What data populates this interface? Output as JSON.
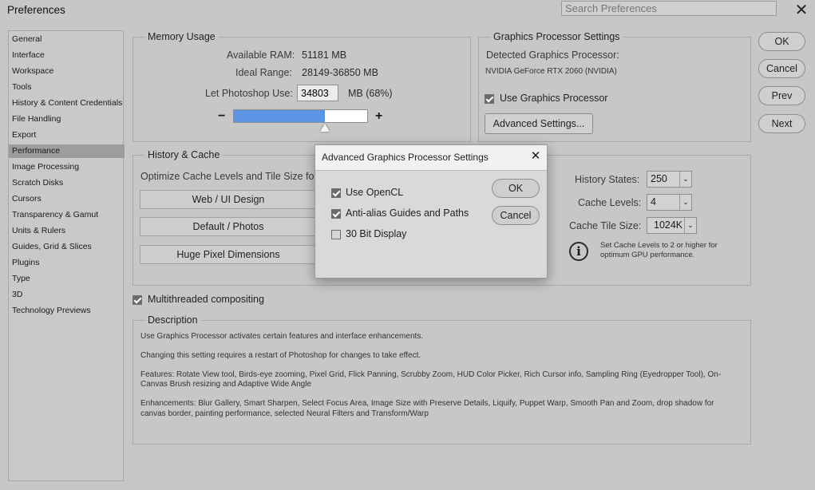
{
  "window": {
    "title": "Preferences",
    "search_placeholder": "Search Preferences",
    "close_glyph": "✕"
  },
  "sidebar": {
    "items": [
      {
        "label": "General"
      },
      {
        "label": "Interface"
      },
      {
        "label": "Workspace"
      },
      {
        "label": "Tools"
      },
      {
        "label": "History & Content Credentials"
      },
      {
        "label": "File Handling"
      },
      {
        "label": "Export"
      },
      {
        "label": "Performance",
        "selected": true
      },
      {
        "label": "Image Processing"
      },
      {
        "label": "Scratch Disks"
      },
      {
        "label": "Cursors"
      },
      {
        "label": "Transparency & Gamut"
      },
      {
        "label": "Units & Rulers"
      },
      {
        "label": "Guides, Grid & Slices"
      },
      {
        "label": "Plugins"
      },
      {
        "label": "Type"
      },
      {
        "label": "3D"
      },
      {
        "label": "Technology Previews"
      }
    ]
  },
  "memory": {
    "title": "Memory Usage",
    "available_label": "Available RAM:",
    "available_value": "51181 MB",
    "ideal_label": "Ideal Range:",
    "ideal_value": "28149-36850 MB",
    "use_label": "Let Photoshop Use:",
    "use_value": "34803",
    "use_unit": "MB (68%)",
    "minus": "−",
    "plus": "+",
    "slider_fraction": 0.68
  },
  "gpu": {
    "title": "Graphics Processor Settings",
    "detected_label": "Detected Graphics Processor:",
    "gpu_name": "NVIDIA GeForce RTX 2060 (NVIDIA)",
    "use_gpu_label": "Use Graphics Processor",
    "use_gpu_checked": true,
    "advanced_button": "Advanced Settings..."
  },
  "history_cache": {
    "title": "History & Cache",
    "optimize_label": "Optimize Cache Levels and Tile Size for",
    "buttons": [
      "Web / UI Design",
      "Default / Photos",
      "Huge Pixel Dimensions"
    ],
    "history_states_label": "History States:",
    "history_states_value": "250",
    "cache_levels_label": "Cache Levels:",
    "cache_levels_value": "4",
    "cache_tile_label": "Cache Tile Size:",
    "cache_tile_value": "1024K",
    "info_line1": "Set Cache Levels to 2 or higher for",
    "info_line2": "optimum GPU performance."
  },
  "multithreaded": {
    "label": "Multithreaded compositing",
    "checked": true
  },
  "description": {
    "title": "Description",
    "p1": "Use Graphics Processor activates certain features and interface enhancements.",
    "p2": "Changing this setting requires a restart of Photoshop for changes to take effect.",
    "p3a": "Features: Rotate View tool, Birds-eye zooming, Pixel Grid, Flick Panning, Scrubby Zoom, HUD Color Picker, Rich Cursor info, Sampling Ring (Eyedropper Tool), On-",
    "p3b": "Canvas Brush resizing and Adaptive Wide Angle",
    "p4a": "Enhancements: Blur Gallery, Smart Sharpen, Select Focus Area, Image Size with Preserve Details, Liquify, Puppet Warp, Smooth Pan and Zoom, drop shadow for",
    "p4b": "canvas border, painting performance, selected Neural Filters and Transform/Warp"
  },
  "right_buttons": {
    "ok": "OK",
    "cancel": "Cancel",
    "prev": "Prev",
    "next": "Next"
  },
  "modal": {
    "title": "Advanced Graphics Processor Settings",
    "close_glyph": "✕",
    "options": [
      {
        "label": "Use OpenCL",
        "checked": true
      },
      {
        "label": "Anti-alias Guides and Paths",
        "checked": true
      },
      {
        "label": "30 Bit Display",
        "checked": false
      }
    ],
    "ok": "OK",
    "cancel": "Cancel"
  },
  "colors": {
    "slider_fill": "#5d95e6",
    "selected_item": "#9d9d9d"
  }
}
